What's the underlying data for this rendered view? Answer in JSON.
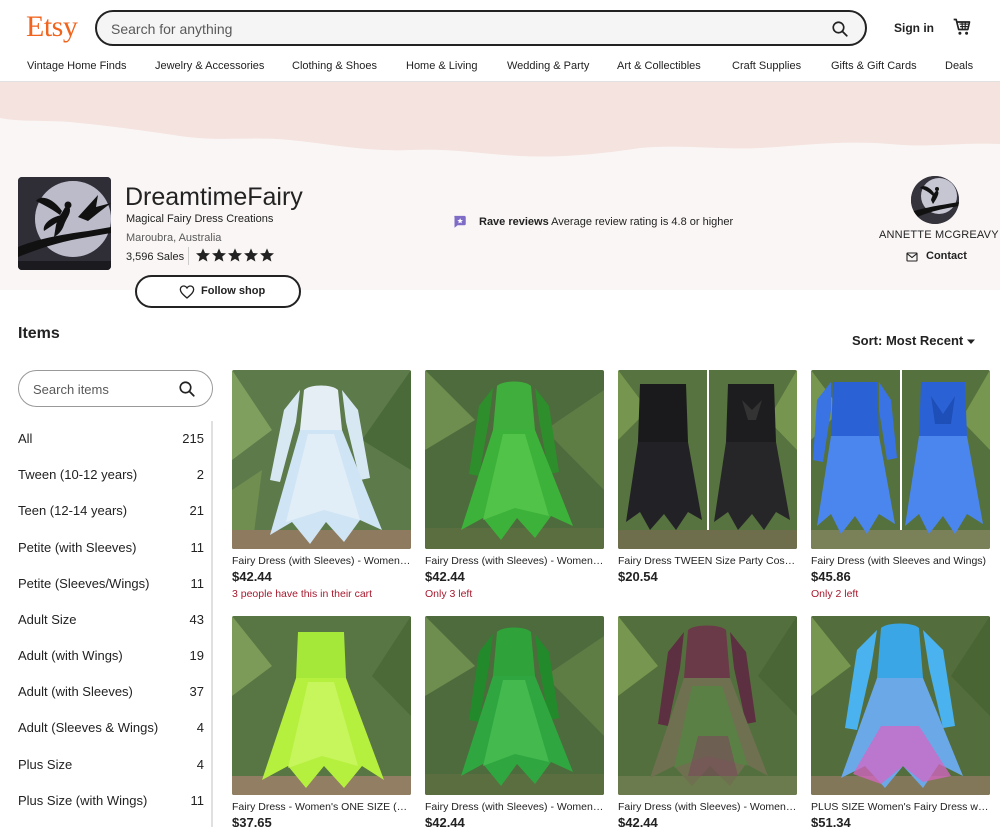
{
  "header": {
    "logo": "Etsy",
    "search_placeholder": "Search for anything",
    "sign_in": "Sign in"
  },
  "nav": [
    "Vintage Home Finds",
    "Jewelry & Accessories",
    "Clothing & Shoes",
    "Home & Living",
    "Wedding & Party",
    "Art & Collectibles",
    "Craft Supplies",
    "Gifts & Gift Cards",
    "Deals"
  ],
  "shop": {
    "name": "DreamtimeFairy",
    "tagline": "Magical Fairy Dress Creations",
    "location": "Maroubra, Australia",
    "sales": "3,596 Sales",
    "rating_stars": 5,
    "follow_label": "Follow shop",
    "rave_label": "Rave reviews",
    "rave_text": "Average review rating is 4.8 or higher",
    "owner_name": "ANNETTE MCGREAVY",
    "contact_label": "Contact"
  },
  "items": {
    "heading": "Items",
    "sort_label": "Sort: Most Recent",
    "search_placeholder": "Search items",
    "categories": [
      {
        "name": "All",
        "count": "215"
      },
      {
        "name": "Tween (10-12 years)",
        "count": "2"
      },
      {
        "name": "Teen (12-14 years)",
        "count": "21"
      },
      {
        "name": "Petite (with Sleeves)",
        "count": "11"
      },
      {
        "name": "Petite (Sleeves/Wings)",
        "count": "11"
      },
      {
        "name": "Adult Size",
        "count": "43"
      },
      {
        "name": "Adult (with Wings)",
        "count": "19"
      },
      {
        "name": "Adult (with Sleeves)",
        "count": "37"
      },
      {
        "name": "Adult (Sleeves & Wings)",
        "count": "4"
      },
      {
        "name": "Plus Size",
        "count": "4"
      },
      {
        "name": "Plus Size (with Wings)",
        "count": "11"
      }
    ],
    "products": [
      {
        "title": "Fairy Dress (with Sleeves) - Women's ONE SIZE",
        "price": "$42.44",
        "note": "3 people have this in their cart"
      },
      {
        "title": "Fairy Dress (with Sleeves) - Women's ONE SIZE",
        "price": "$42.44",
        "note": "Only 3 left"
      },
      {
        "title": "Fairy Dress TWEEN Size Party Costume",
        "price": "$20.54",
        "note": ""
      },
      {
        "title": "Fairy Dress (with Sleeves and Wings)",
        "price": "$45.86",
        "note": "Only 2 left"
      },
      {
        "title": "Fairy Dress - Women's ONE SIZE (Adult)",
        "price": "$37.65",
        "note": ""
      },
      {
        "title": "Fairy Dress (with Sleeves) - Women's ONE SIZE",
        "price": "$42.44",
        "note": ""
      },
      {
        "title": "Fairy Dress (with Sleeves) - Women's ONE SIZE",
        "price": "$42.44",
        "note": ""
      },
      {
        "title": "PLUS SIZE Women's Fairy Dress with Sleeves",
        "price": "$51.34",
        "note": ""
      }
    ]
  },
  "colors": {
    "brand": "#f1641e",
    "banner": "#f4e3df",
    "rave": "#7f6cc7",
    "note_red": "#a61a2e"
  }
}
